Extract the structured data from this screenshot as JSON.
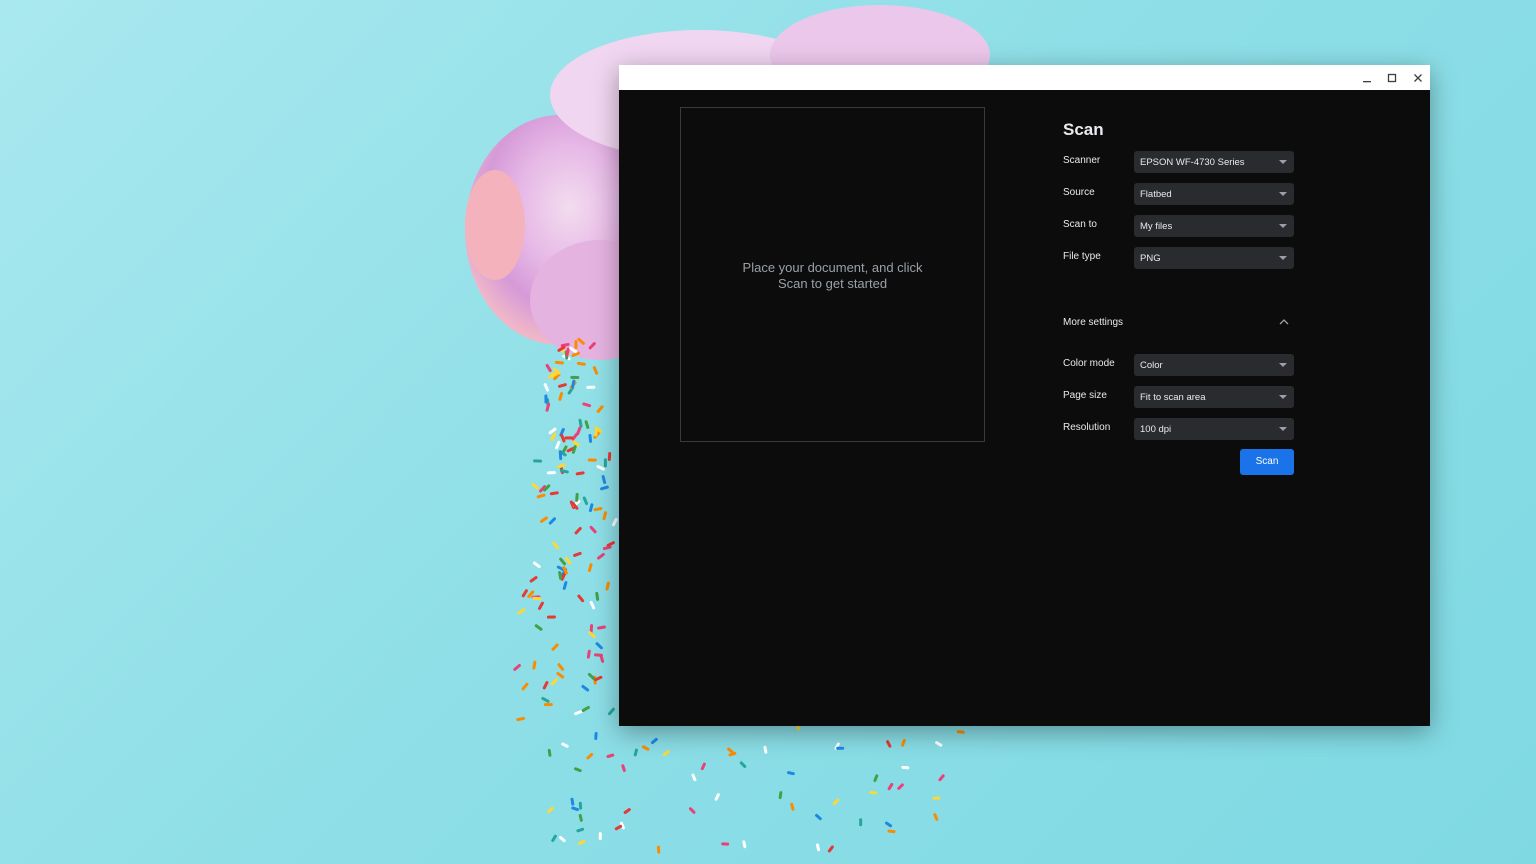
{
  "window": {
    "controls": {
      "minimize_icon": "minimize-icon",
      "maximize_icon": "maximize-icon",
      "close_icon": "close-icon"
    }
  },
  "preview": {
    "message_line1": "Place your document, and click",
    "message_line2": "Scan to get started"
  },
  "panel": {
    "title": "Scan",
    "fields": [
      {
        "label": "Scanner",
        "value": "EPSON WF-4730 Series"
      },
      {
        "label": "Source",
        "value": "Flatbed"
      },
      {
        "label": "Scan to",
        "value": "My files"
      },
      {
        "label": "File type",
        "value": "PNG"
      }
    ],
    "more_settings_label": "More settings",
    "more_fields": [
      {
        "label": "Color mode",
        "value": "Color"
      },
      {
        "label": "Page size",
        "value": "Fit to scan area"
      },
      {
        "label": "Resolution",
        "value": "100 dpi"
      }
    ],
    "scan_button_label": "Scan"
  },
  "colors": {
    "accent": "#1a73e8",
    "window_bg": "#0c0c0d",
    "select_bg": "#2a2b2e",
    "text": "#e8eaed",
    "muted_text": "#9aa0a6"
  }
}
